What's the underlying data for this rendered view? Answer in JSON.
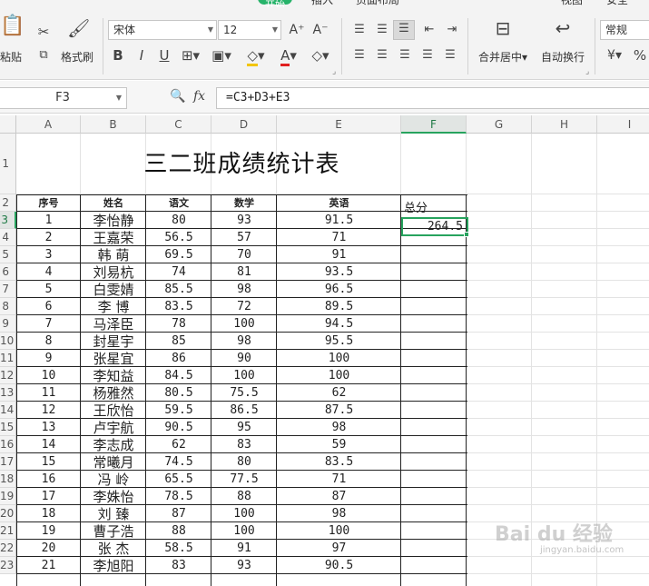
{
  "ribbon": {
    "tabs": [
      "插入",
      "页面布局",
      "视图",
      "安全"
    ],
    "paste_label": "粘贴",
    "format_painter_label": "格式刷",
    "font_name": "宋体",
    "font_size": "12",
    "merge_center_label": "合并居中",
    "wrap_text_label": "自动换行",
    "number_format": "常规",
    "icons": [
      "paste-icon",
      "cut-icon",
      "copy-icon",
      "format-painter-icon",
      "bold-icon",
      "italic-icon",
      "underline-icon",
      "border-icon",
      "fill-color-icon",
      "font-color-icon",
      "clear-icon",
      "align-icon",
      "merge-center-icon",
      "wrap-text-icon",
      "currency-icon",
      "percent-icon"
    ]
  },
  "formula_bar": {
    "name_box": "F3",
    "formula": "=C3+D3+E3",
    "fx_label": "fx"
  },
  "grid": {
    "columns": [
      "A",
      "B",
      "C",
      "D",
      "E",
      "F",
      "G",
      "H",
      "I"
    ],
    "selected_column": "F",
    "selected_row": "3",
    "row_numbers": [
      "1",
      "2",
      "3",
      "4",
      "5",
      "6",
      "7",
      "8",
      "9",
      "10",
      "11",
      "12",
      "13",
      "14",
      "15",
      "16",
      "17",
      "18",
      "19",
      "20",
      "21",
      "22",
      "23"
    ]
  },
  "sheet": {
    "title": "三二班成绩统计表",
    "headers": [
      "序号",
      "姓名",
      "语文",
      "数学",
      "英语"
    ],
    "total_header": "总分",
    "total_value_f3": "264.5",
    "rows": [
      [
        "1",
        "李怡静",
        "80",
        "93",
        "91.5"
      ],
      [
        "2",
        "王嘉荣",
        "56.5",
        "57",
        "71"
      ],
      [
        "3",
        "韩 萌",
        "69.5",
        "70",
        "91"
      ],
      [
        "4",
        "刘易杭",
        "74",
        "81",
        "93.5"
      ],
      [
        "5",
        "白雯婧",
        "85.5",
        "98",
        "96.5"
      ],
      [
        "6",
        "李 博",
        "83.5",
        "72",
        "89.5"
      ],
      [
        "7",
        "马泽臣",
        "78",
        "100",
        "94.5"
      ],
      [
        "8",
        "封星宇",
        "85",
        "98",
        "95.5"
      ],
      [
        "9",
        "张星宜",
        "86",
        "90",
        "100"
      ],
      [
        "10",
        "李知益",
        "84.5",
        "100",
        "100"
      ],
      [
        "11",
        "杨雅然",
        "80.5",
        "75.5",
        "62"
      ],
      [
        "12",
        "王欣怡",
        "59.5",
        "86.5",
        "87.5"
      ],
      [
        "13",
        "卢宇航",
        "90.5",
        "95",
        "98"
      ],
      [
        "14",
        "李志成",
        "62",
        "83",
        "59"
      ],
      [
        "15",
        "常曦月",
        "74.5",
        "80",
        "83.5"
      ],
      [
        "16",
        "冯 岭",
        "65.5",
        "77.5",
        "71"
      ],
      [
        "17",
        "李姝怡",
        "78.5",
        "88",
        "87"
      ],
      [
        "18",
        "刘 臻",
        "87",
        "100",
        "98"
      ],
      [
        "19",
        "曹子浩",
        "88",
        "100",
        "100"
      ],
      [
        "20",
        "张 杰",
        "58.5",
        "91",
        "97"
      ],
      [
        "21",
        "李旭阳",
        "83",
        "93",
        "90.5"
      ]
    ]
  },
  "watermark": {
    "main": "Bai du 经验",
    "sub": "jingyan.baidu.com"
  }
}
